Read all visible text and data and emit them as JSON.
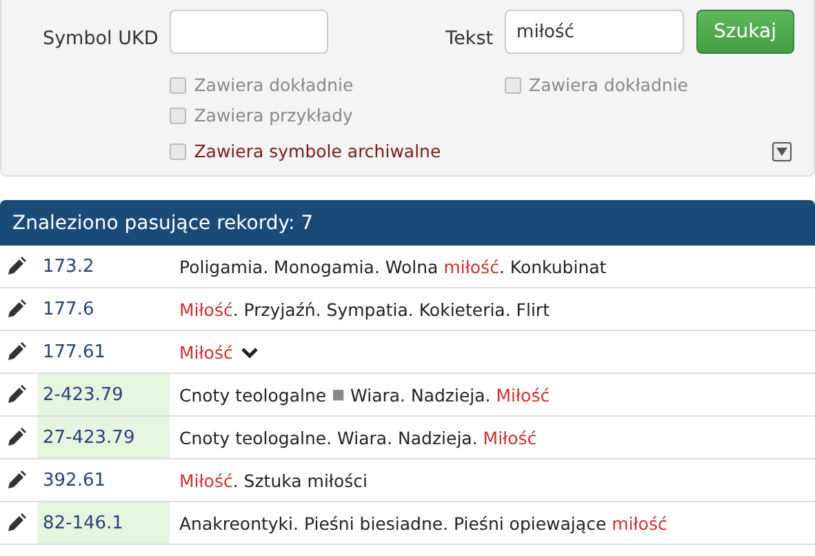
{
  "search": {
    "symbol_label": "Symbol UKD",
    "text_label": "Tekst",
    "text_value": "miłość",
    "button": "Szukaj",
    "symbol_options": [
      {
        "label": "Zawiera dokładnie",
        "checked": false
      },
      {
        "label": "Zawiera przykłady",
        "checked": false
      }
    ],
    "text_options": [
      {
        "label": "Zawiera dokładnie",
        "checked": false
      }
    ],
    "archive_option": {
      "label": "Zawiera symbole archiwalne",
      "checked": false
    }
  },
  "results": {
    "title": "Znaleziono pasujące rekordy: 7",
    "rows": [
      {
        "code": "173.2",
        "highlighted": false,
        "expandable": false,
        "parts": [
          {
            "kind": "text",
            "text": "Poligamia. Monogamia. Wolna "
          },
          {
            "kind": "match",
            "text": "miłość"
          },
          {
            "kind": "text",
            "text": ". Konkubinat"
          }
        ]
      },
      {
        "code": "177.6",
        "highlighted": false,
        "expandable": false,
        "parts": [
          {
            "kind": "match",
            "text": "Miłość"
          },
          {
            "kind": "text",
            "text": ". Przyjaźń. Sympatia. Kokieteria. Flirt"
          }
        ]
      },
      {
        "code": "177.61",
        "highlighted": false,
        "expandable": true,
        "parts": [
          {
            "kind": "match",
            "text": "Miłość"
          }
        ]
      },
      {
        "code": "2-423.79",
        "highlighted": true,
        "expandable": false,
        "parts": [
          {
            "kind": "text",
            "text": "Cnoty teologalne "
          },
          {
            "kind": "separator",
            "text": "■"
          },
          {
            "kind": "text",
            "text": " Wiara. Nadzieja. "
          },
          {
            "kind": "match",
            "text": "Miłość"
          }
        ]
      },
      {
        "code": "27-423.79",
        "highlighted": true,
        "expandable": false,
        "parts": [
          {
            "kind": "text",
            "text": "Cnoty teologalne. Wiara. Nadzieja. "
          },
          {
            "kind": "match",
            "text": "Miłość"
          }
        ]
      },
      {
        "code": "392.61",
        "highlighted": false,
        "expandable": false,
        "parts": [
          {
            "kind": "match",
            "text": "Miłość"
          },
          {
            "kind": "text",
            "text": ". Sztuka miłości"
          }
        ]
      },
      {
        "code": "82-146.1",
        "highlighted": true,
        "expandable": false,
        "parts": [
          {
            "kind": "text",
            "text": "Anakreontyki. Pieśni biesiadne. Pieśni opiewające "
          },
          {
            "kind": "match",
            "text": "miłość"
          }
        ]
      }
    ]
  }
}
